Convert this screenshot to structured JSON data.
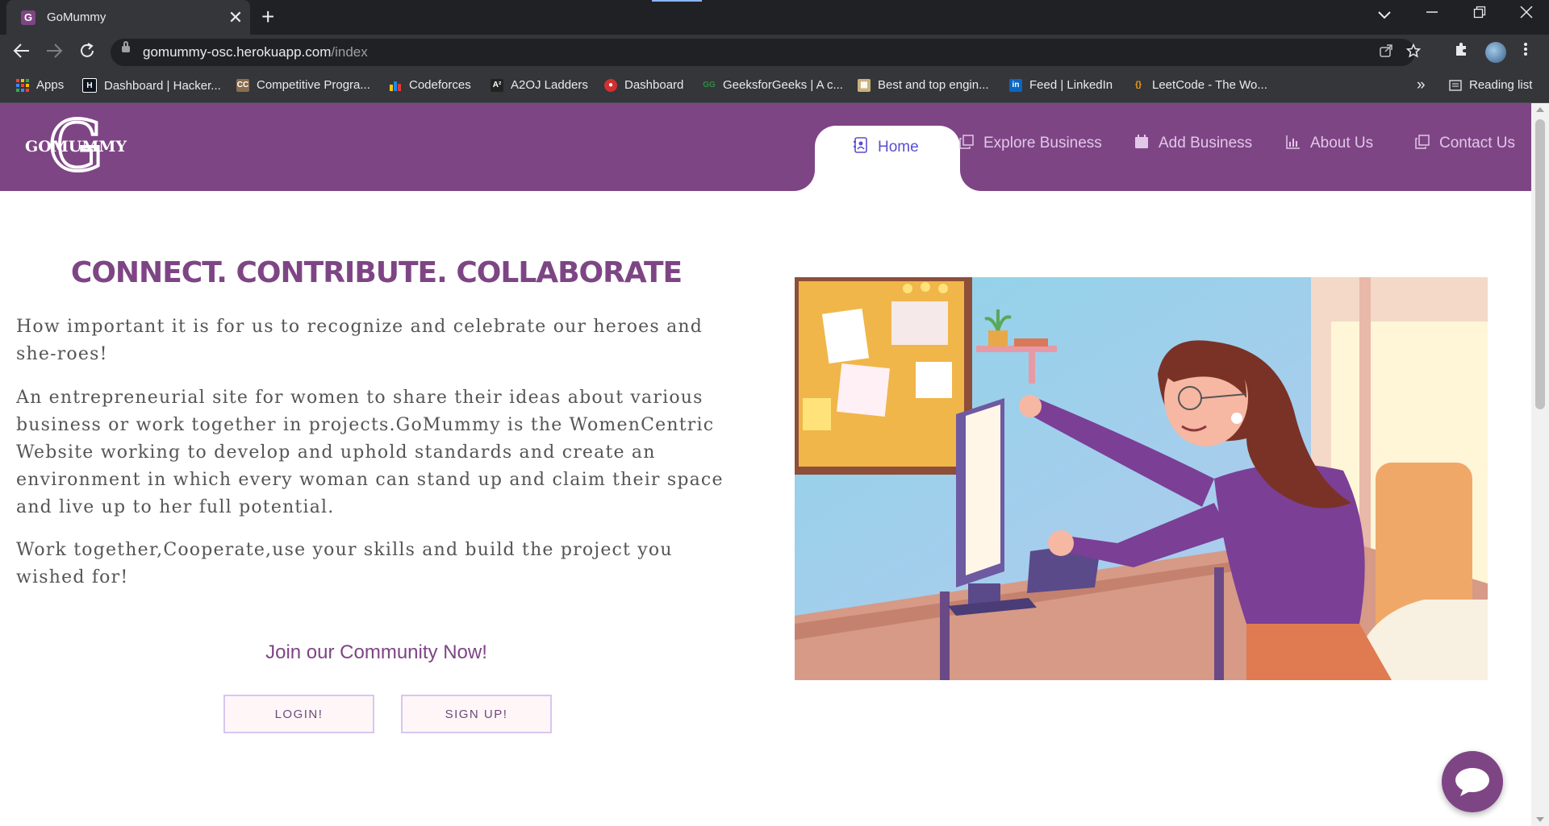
{
  "browser": {
    "tab_title": "GoMummy",
    "tab_favicon_letter": "G",
    "tab_close": "✕",
    "new_tab": "+",
    "url_host": "gomummy-osc.herokuapp.com",
    "url_path": "/index",
    "bookmarks": [
      {
        "label": "Apps",
        "icon": "apps-grid-icon"
      },
      {
        "label": "Dashboard | Hacker...",
        "icon": "hackerrank-icon"
      },
      {
        "label": "Competitive Progra...",
        "icon": "cc-icon"
      },
      {
        "label": "Codeforces",
        "icon": "codeforces-icon"
      },
      {
        "label": "A2OJ Ladders",
        "icon": "a2oj-icon"
      },
      {
        "label": "Dashboard",
        "icon": "dashboard-icon"
      },
      {
        "label": "GeeksforGeeks | A c...",
        "icon": "gfg-icon"
      },
      {
        "label": "Best and top engin...",
        "icon": "engineering-icon"
      },
      {
        "label": "Feed | LinkedIn",
        "icon": "linkedin-icon"
      },
      {
        "label": "LeetCode - The Wo...",
        "icon": "leetcode-icon"
      }
    ],
    "overflow": "»",
    "reading_list": "Reading list"
  },
  "site": {
    "brand": "GOMUMMY",
    "brand_letter": "G",
    "nav": [
      {
        "label": "Home",
        "icon": "contact-card-icon",
        "active": true
      },
      {
        "label": "Explore Business",
        "icon": "copy-icon"
      },
      {
        "label": "Add Business",
        "icon": "calendar-icon"
      },
      {
        "label": "About Us",
        "icon": "bar-chart-icon"
      },
      {
        "label": "Contact Us",
        "icon": "copy-icon"
      }
    ],
    "headline": "CONNECT. CONTRIBUTE. COLLABORATE",
    "paragraphs": [
      "How important it is for us to recognize and celebrate our heroes and she-roes!",
      "An entrepreneurial site for women to share their ideas about various business or work together in projects.GoMummy is the WomenCentric Website working to develop and uphold standards and create an environment in which every woman can stand up and claim their space and live up to her full potential.",
      "Work together,Cooperate,use your skills and build the project you wished for!"
    ],
    "join_text": "Join our Community Now!",
    "login_label": "LOGIN!",
    "signup_label": "SIGN UP!"
  },
  "colors": {
    "brand": "#7e4585",
    "active_nav_text": "#5a4fcf",
    "body_text": "#555555"
  }
}
